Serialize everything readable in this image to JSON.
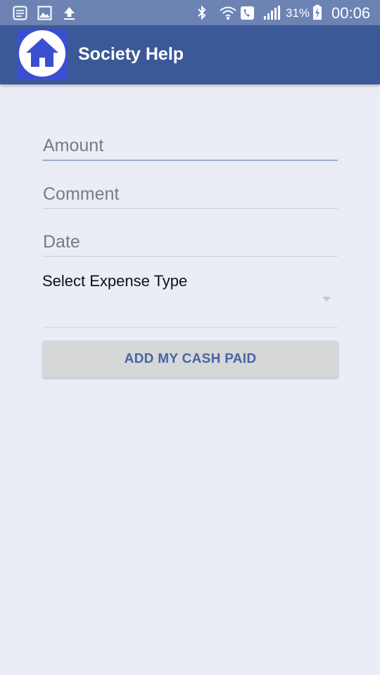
{
  "status_bar": {
    "battery_percent": "31%",
    "time": "00:06",
    "icons": [
      "notes-icon",
      "gallery-icon",
      "upload-icon",
      "bluetooth-icon",
      "wifi-calling-icon",
      "phone-icon",
      "signal-icon",
      "battery-charging-icon"
    ]
  },
  "app_bar": {
    "title": "Society Help",
    "logo_icon": "home-icon",
    "logo_color": "#3a4fd0",
    "bar_color": "#3b5998"
  },
  "form": {
    "amount": {
      "placeholder": "Amount",
      "value": ""
    },
    "comment": {
      "placeholder": "Comment",
      "value": ""
    },
    "date": {
      "placeholder": "Date",
      "value": ""
    },
    "expense_type": {
      "label": "Select Expense Type",
      "selected": ""
    },
    "submit_label": "ADD MY CASH PAID"
  }
}
